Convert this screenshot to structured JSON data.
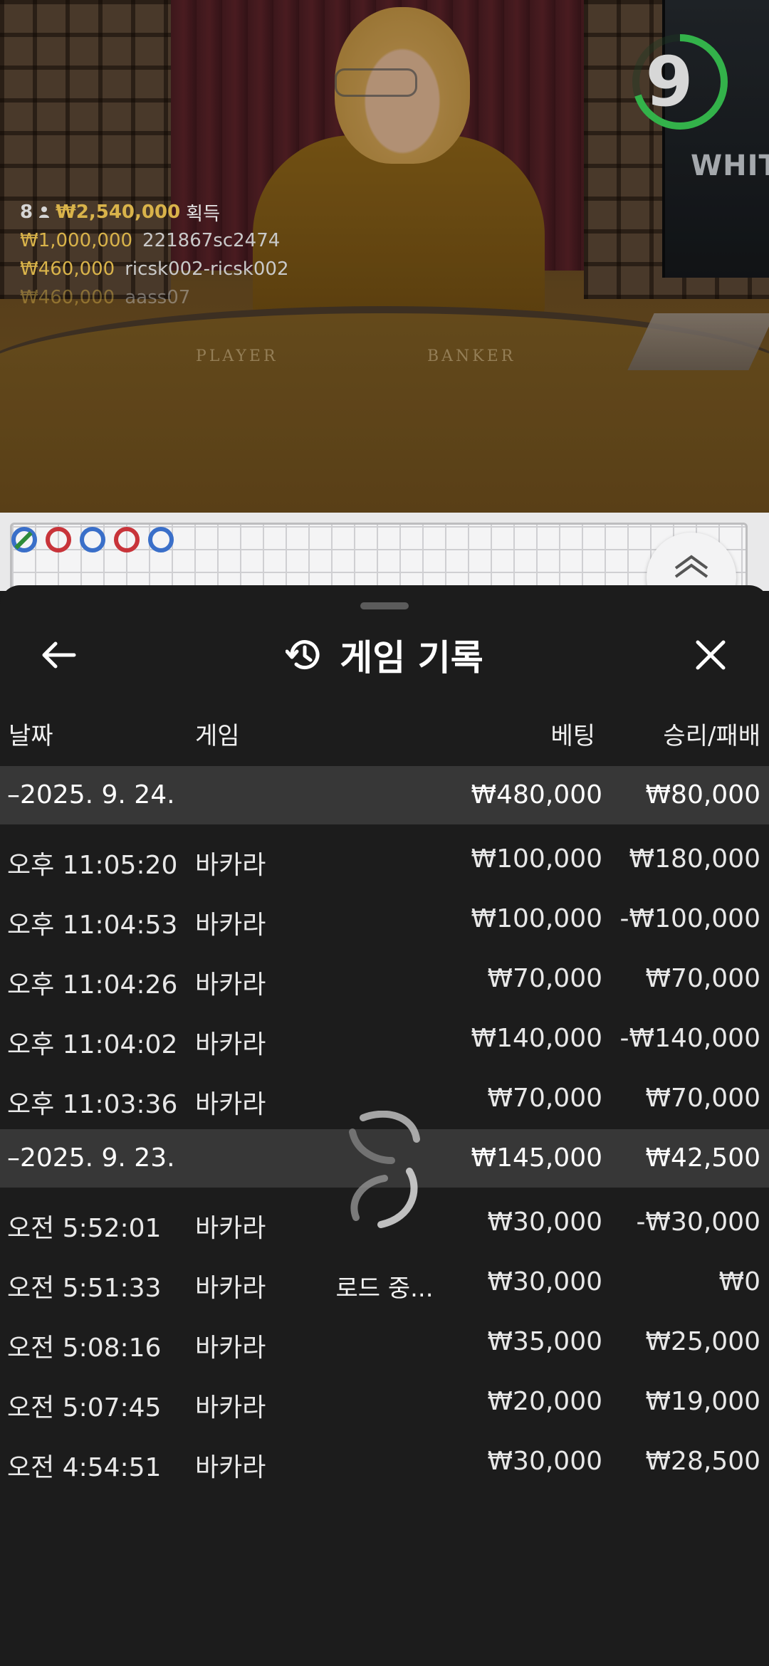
{
  "video": {
    "timer_value": "9",
    "timer_progress": 0.7,
    "monitor_text": "WHITE",
    "table_labels": {
      "player": "PLAYER",
      "banker": "BANKER"
    },
    "winners": {
      "count": "8",
      "total": "₩2,540,000",
      "total_label": "획득",
      "rows": [
        {
          "amount": "₩1,000,000",
          "name": "221867sc2474"
        },
        {
          "amount": "₩460,000",
          "name": "ricsk002-ricsk002"
        },
        {
          "amount": "₩460,000",
          "name": "aass07"
        }
      ]
    }
  },
  "road": {
    "beads": [
      {
        "color": "#3a6fc9",
        "slash": true
      },
      {
        "color": "#c8343a"
      },
      {
        "color": "#3a6fc9"
      },
      {
        "color": "#c8343a"
      },
      {
        "color": "#3a6fc9"
      }
    ]
  },
  "history": {
    "title": "게임 기록",
    "back_icon": "arrow-left-icon",
    "close_icon": "close-icon",
    "history_icon": "history-icon",
    "columns": {
      "date": "날짜",
      "game": "게임",
      "bet": "베팅",
      "result": "승리/패배"
    },
    "groups": [
      {
        "date": "–2025. 9. 24.",
        "bet": "₩480,000",
        "result": "₩80,000",
        "rows": [
          {
            "time": "오후 11:05:20",
            "game": "바카라",
            "bet": "₩100,000",
            "result": "₩180,000"
          },
          {
            "time": "오후 11:04:53",
            "game": "바카라",
            "bet": "₩100,000",
            "result": "-₩100,000"
          },
          {
            "time": "오후 11:04:26",
            "game": "바카라",
            "bet": "₩70,000",
            "result": "₩70,000"
          },
          {
            "time": "오후 11:04:02",
            "game": "바카라",
            "bet": "₩140,000",
            "result": "-₩140,000"
          },
          {
            "time": "오후 11:03:36",
            "game": "바카라",
            "bet": "₩70,000",
            "result": "₩70,000"
          }
        ]
      },
      {
        "date": "–2025. 9. 23.",
        "bet": "₩145,000",
        "result": "₩42,500",
        "rows": [
          {
            "time": "오전 5:52:01",
            "game": "바카라",
            "bet": "₩30,000",
            "result": "-₩30,000"
          },
          {
            "time": "오전 5:51:33",
            "game": "바카라",
            "bet": "₩30,000",
            "result": "₩0"
          },
          {
            "time": "오전 5:08:16",
            "game": "바카라",
            "bet": "₩35,000",
            "result": "₩25,000"
          },
          {
            "time": "오전 5:07:45",
            "game": "바카라",
            "bet": "₩20,000",
            "result": "₩19,000"
          },
          {
            "time": "오전 4:54:51",
            "game": "바카라",
            "bet": "₩30,000",
            "result": "₩28,500"
          }
        ]
      }
    ],
    "loading_text": "로드 중..."
  }
}
